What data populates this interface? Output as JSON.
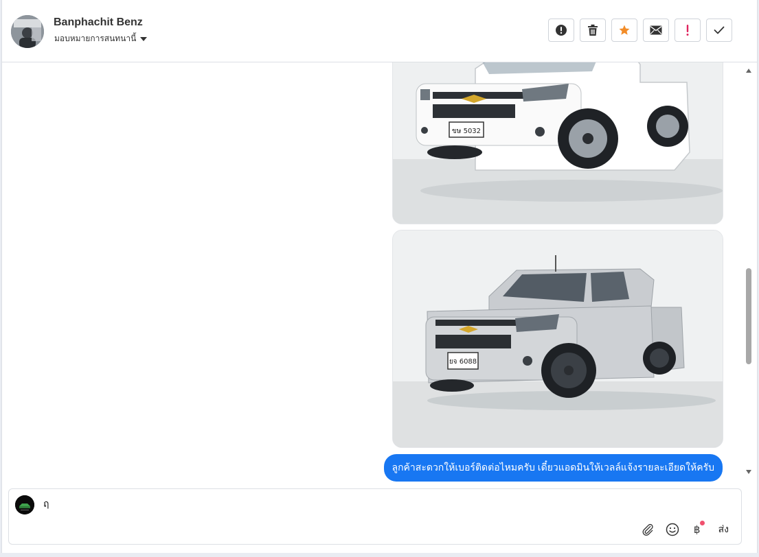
{
  "header": {
    "contact_name": "Banphachit Benz",
    "assign_label": "มอบหมายการสนทนานี้",
    "actions": [
      {
        "name": "alert-icon"
      },
      {
        "name": "trash-icon"
      },
      {
        "name": "star-icon",
        "color": "#f28c28"
      },
      {
        "name": "mail-icon"
      },
      {
        "name": "important-icon",
        "color": "#e0245e"
      },
      {
        "name": "check-icon"
      }
    ]
  },
  "messages": {
    "photo_1": {
      "plate": "ขษ 5032",
      "color": "#ffffff"
    },
    "photo_2": {
      "plate": "ยจ 6088",
      "color": "#c9ccd0"
    },
    "text_bubble": "ลูกค้าสะดวกให้เบอร์ติดต่อไหมครับ เดี๋ยวแอดมินให้เวลล์แจ้งรายละเอียดให้ครับ",
    "bubble_color": "#1877f2"
  },
  "composer": {
    "value": "ฤ",
    "tools": [
      "paperclip-icon",
      "emoji-icon",
      "baht-icon"
    ],
    "baht_symbol": "฿",
    "send_label": "ส่ง"
  }
}
